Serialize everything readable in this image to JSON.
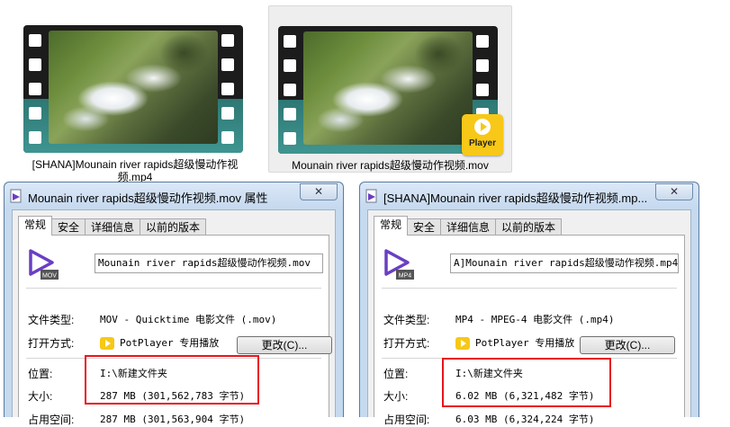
{
  "files": [
    {
      "name": "[SHANA]Mounain river rapids超级慢动作视频.mp4",
      "selected": false
    },
    {
      "name": "Mounain river rapids超级慢动作视频.mov",
      "selected": true,
      "badge": "Player"
    }
  ],
  "dialogs": [
    {
      "title": "Mounain river rapids超级慢动作视频.mov 属性",
      "close_label": "✕",
      "tabs": [
        "常规",
        "安全",
        "详细信息",
        "以前的版本"
      ],
      "active_tab": "常规",
      "icon_tag": "MOV",
      "filename": "Mounain river rapids超级慢动作视频.mov",
      "type_label": "文件类型:",
      "type_value": "MOV - Quicktime 电影文件 (.mov)",
      "open_label": "打开方式:",
      "open_app": "PotPlayer 专用播放",
      "change_button": "更改(C)...",
      "location_label": "位置:",
      "location_value": "I:\\新建文件夹",
      "size_label": "大小:",
      "size_value": "287 MB (301,562,783 字节)",
      "disk_label": "占用空间:",
      "disk_value": "287 MB (301,563,904 字节)"
    },
    {
      "title": "[SHANA]Mounain river rapids超级慢动作视频.mp...",
      "close_label": "✕",
      "tabs": [
        "常规",
        "安全",
        "详细信息",
        "以前的版本"
      ],
      "active_tab": "常规",
      "icon_tag": "MP4",
      "filename": "A]Mounain river rapids超级慢动作视频.mp4",
      "type_label": "文件类型:",
      "type_value": "MP4 - MPEG-4 电影文件 (.mp4)",
      "open_label": "打开方式:",
      "open_app": "PotPlayer 专用播放",
      "change_button": "更改(C)...",
      "location_label": "位置:",
      "location_value": "I:\\新建文件夹",
      "size_label": "大小:",
      "size_value": "6.02 MB (6,321,482 字节)",
      "disk_label": "占用空间:",
      "disk_value": "6.03 MB (6,324,224 字节)"
    }
  ],
  "colors": {
    "highlight_box": "#e8131b",
    "player_badge": "#f7c817",
    "icon_purple": "#6a3fc3",
    "dialog_frame": "#c5d9ef"
  }
}
